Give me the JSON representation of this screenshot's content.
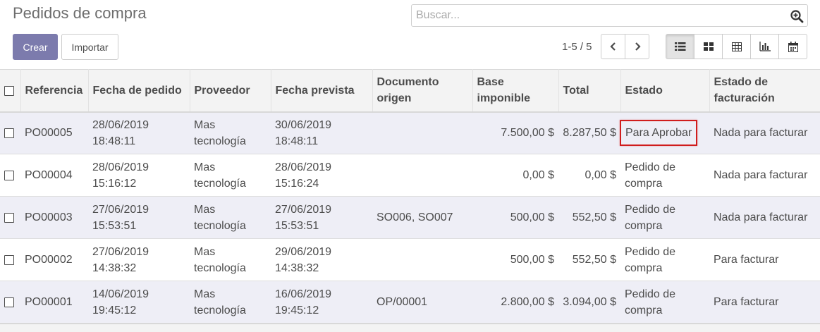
{
  "page": {
    "title": "Pedidos de compra",
    "search_placeholder": "Buscar...",
    "create_label": "Crear",
    "import_label": "Importar",
    "pager": "1-5 / 5"
  },
  "icons": {
    "search": "search-plus-icon",
    "prev": "chevron-left-icon",
    "next": "chevron-right-icon",
    "views": [
      "list-view-icon",
      "kanban-view-icon",
      "pivot-view-icon",
      "graph-view-icon",
      "calendar-view-icon"
    ]
  },
  "colors": {
    "primary": "#7c7bad",
    "highlight": "#d01d1d",
    "row_alt": "#eeeef6"
  },
  "table": {
    "headers": {
      "ref": "Referencia",
      "date": "Fecha de pedido",
      "vendor": "Proveedor",
      "expected": "Fecha prevista",
      "origin_l1": "Documento",
      "origin_l2": "origen",
      "base_l1": "Base",
      "base_l2": "imponible",
      "total": "Total",
      "state": "Estado",
      "inv_l1": "Estado de",
      "inv_l2": "facturación"
    },
    "rows": [
      {
        "ref": "PO00005",
        "date_d": "28/06/2019",
        "date_t": "18:48:11",
        "vendor_1": "Mas",
        "vendor_2": "tecnología",
        "exp_d": "30/06/2019",
        "exp_t": "18:48:11",
        "origin": "",
        "base": "7.500,00 $",
        "total": "8.287,50 $",
        "state_1": "Para Aprobar",
        "state_2": "",
        "invoice": "Nada para facturar"
      },
      {
        "ref": "PO00004",
        "date_d": "28/06/2019",
        "date_t": "15:16:12",
        "vendor_1": "Mas",
        "vendor_2": "tecnología",
        "exp_d": "28/06/2019",
        "exp_t": "15:16:24",
        "origin": "",
        "base": "0,00 $",
        "total": "0,00 $",
        "state_1": "Pedido de",
        "state_2": "compra",
        "invoice": "Nada para facturar"
      },
      {
        "ref": "PO00003",
        "date_d": "27/06/2019",
        "date_t": "15:53:51",
        "vendor_1": "Mas",
        "vendor_2": "tecnología",
        "exp_d": "27/06/2019",
        "exp_t": "15:53:51",
        "origin": "SO006, SO007",
        "base": "500,00 $",
        "total": "552,50 $",
        "state_1": "Pedido de",
        "state_2": "compra",
        "invoice": "Nada para facturar"
      },
      {
        "ref": "PO00002",
        "date_d": "27/06/2019",
        "date_t": "14:38:32",
        "vendor_1": "Mas",
        "vendor_2": "tecnología",
        "exp_d": "29/06/2019",
        "exp_t": "14:38:32",
        "origin": "",
        "base": "500,00 $",
        "total": "552,50 $",
        "state_1": "Pedido de",
        "state_2": "compra",
        "invoice": "Para facturar"
      },
      {
        "ref": "PO00001",
        "date_d": "14/06/2019",
        "date_t": "19:45:12",
        "vendor_1": "Mas",
        "vendor_2": "tecnología",
        "exp_d": "16/06/2019",
        "exp_t": "19:45:12",
        "origin": "OP/00001",
        "base": "2.800,00 $",
        "total": "3.094,00 $",
        "state_1": "Pedido de",
        "state_2": "compra",
        "invoice": "Para facturar"
      }
    ]
  }
}
